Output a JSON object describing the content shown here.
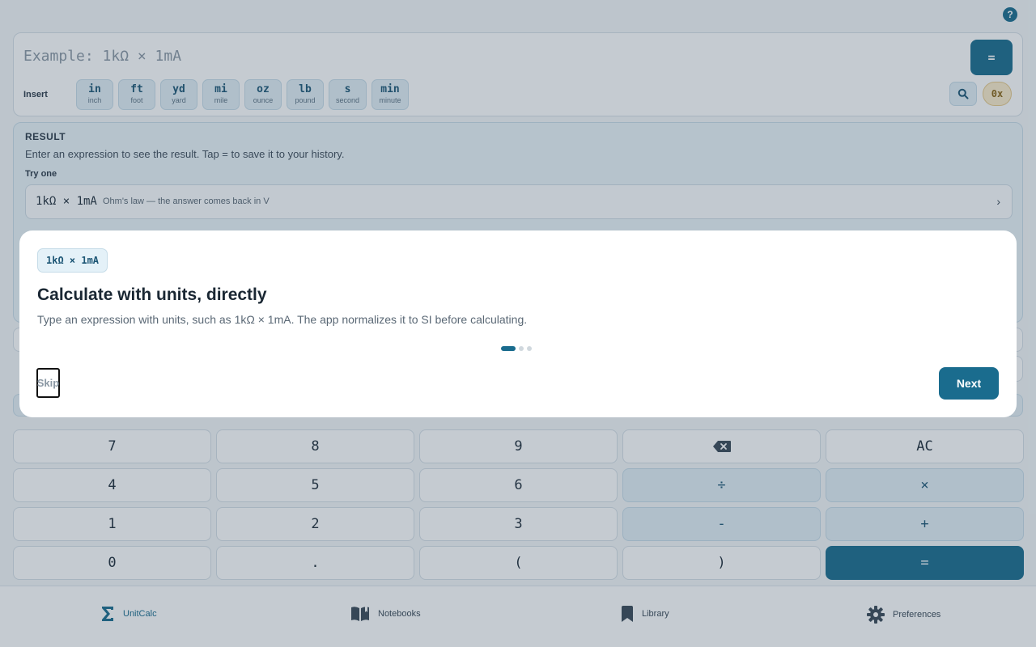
{
  "help": {
    "label": "?"
  },
  "input": {
    "placeholder": "Example: 1kΩ × 1mA",
    "equals_label": "=",
    "insert_label": "Insert",
    "units": [
      {
        "symbol": "in",
        "name": "inch"
      },
      {
        "symbol": "ft",
        "name": "foot"
      },
      {
        "symbol": "yd",
        "name": "yard"
      },
      {
        "symbol": "mi",
        "name": "mile"
      },
      {
        "symbol": "oz",
        "name": "ounce"
      },
      {
        "symbol": "lb",
        "name": "pound"
      },
      {
        "symbol": "s",
        "name": "second"
      },
      {
        "symbol": "min",
        "name": "minute"
      }
    ],
    "hex_label": "0x"
  },
  "result": {
    "title": "RESULT",
    "hint": "Enter an expression to see the result. Tap = to save it to your history.",
    "try_label": "Try one",
    "example": {
      "expr": "1kΩ × 1mA",
      "desc": "Ohm's law — the answer comes back in V",
      "chevron": "›"
    }
  },
  "keypad": {
    "keys": [
      "7",
      "8",
      "9",
      "⌫",
      "AC",
      "4",
      "5",
      "6",
      "÷",
      "×",
      "1",
      "2",
      "3",
      "-",
      "+",
      "0",
      ".",
      "(",
      ")",
      "="
    ]
  },
  "nav": {
    "items": [
      {
        "label": "UnitCalc",
        "icon": "sigma-icon",
        "active": true
      },
      {
        "label": "Notebooks",
        "icon": "book-icon",
        "active": false
      },
      {
        "label": "Library",
        "icon": "bookmark-icon",
        "active": false
      },
      {
        "label": "Preferences",
        "icon": "gear-icon",
        "active": false
      }
    ]
  },
  "onboarding": {
    "chip": "1kΩ × 1mA",
    "title": "Calculate with units, directly",
    "description": "Type an expression with units, such as 1kΩ × 1mA. The app normalizes it to SI before calculating.",
    "step": 1,
    "total_steps": 3,
    "skip_label": "Skip",
    "next_label": "Next"
  },
  "colors": {
    "accent": "#1a6c8e",
    "hex_chip": "#fbeccb"
  }
}
